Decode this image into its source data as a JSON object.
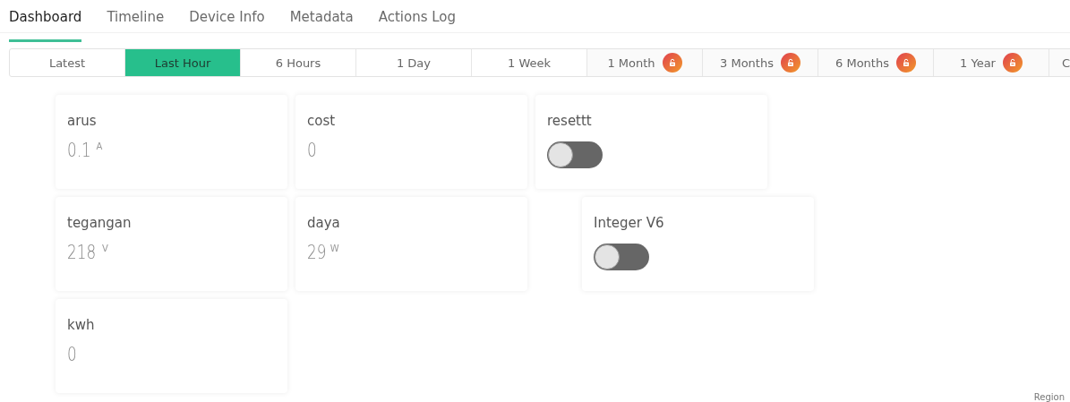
{
  "tabs": [
    {
      "label": "Dashboard",
      "selected": true
    },
    {
      "label": "Timeline",
      "selected": false
    },
    {
      "label": "Device Info",
      "selected": false
    },
    {
      "label": "Metadata",
      "selected": false
    },
    {
      "label": "Actions Log",
      "selected": false
    }
  ],
  "ranges": [
    {
      "label": "Latest",
      "selected": false,
      "locked": false
    },
    {
      "label": "Last Hour",
      "selected": true,
      "locked": false
    },
    {
      "label": "6 Hours",
      "selected": false,
      "locked": false
    },
    {
      "label": "1 Day",
      "selected": false,
      "locked": false
    },
    {
      "label": "1 Week",
      "selected": false,
      "locked": false
    },
    {
      "label": "1 Month",
      "selected": false,
      "locked": true
    },
    {
      "label": "3 Months",
      "selected": false,
      "locked": true
    },
    {
      "label": "6 Months",
      "selected": false,
      "locked": true
    },
    {
      "label": "1 Year",
      "selected": false,
      "locked": true
    },
    {
      "label": "C",
      "selected": false
    }
  ],
  "widget_rows": [
    [
      {
        "kind": "value",
        "title": "arus",
        "value": "0.1",
        "unit": "A"
      },
      {
        "kind": "value",
        "title": "cost",
        "value": "0"
      },
      {
        "kind": "switch",
        "title": "resettt",
        "on": false
      }
    ],
    [
      {
        "kind": "value",
        "title": "tegangan",
        "value": "218",
        "unit": "V"
      },
      {
        "kind": "value",
        "title": "daya",
        "value": "29",
        "unit": "W"
      },
      {
        "kind": "switch",
        "title": "Integer V6",
        "on": false
      }
    ],
    [
      {
        "kind": "value",
        "title": "kwh",
        "value": "0"
      }
    ]
  ],
  "footer": "Region"
}
